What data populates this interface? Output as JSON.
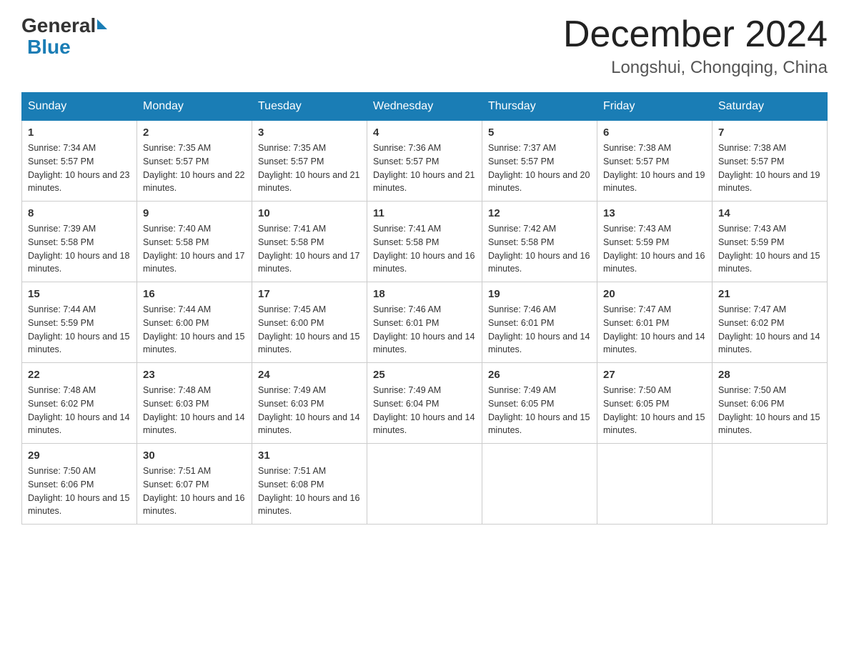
{
  "header": {
    "logo_general": "General",
    "logo_blue": "Blue",
    "month_title": "December 2024",
    "location": "Longshui, Chongqing, China"
  },
  "days_of_week": [
    "Sunday",
    "Monday",
    "Tuesday",
    "Wednesday",
    "Thursday",
    "Friday",
    "Saturday"
  ],
  "weeks": [
    [
      {
        "day": "1",
        "sunrise": "7:34 AM",
        "sunset": "5:57 PM",
        "daylight": "10 hours and 23 minutes."
      },
      {
        "day": "2",
        "sunrise": "7:35 AM",
        "sunset": "5:57 PM",
        "daylight": "10 hours and 22 minutes."
      },
      {
        "day": "3",
        "sunrise": "7:35 AM",
        "sunset": "5:57 PM",
        "daylight": "10 hours and 21 minutes."
      },
      {
        "day": "4",
        "sunrise": "7:36 AM",
        "sunset": "5:57 PM",
        "daylight": "10 hours and 21 minutes."
      },
      {
        "day": "5",
        "sunrise": "7:37 AM",
        "sunset": "5:57 PM",
        "daylight": "10 hours and 20 minutes."
      },
      {
        "day": "6",
        "sunrise": "7:38 AM",
        "sunset": "5:57 PM",
        "daylight": "10 hours and 19 minutes."
      },
      {
        "day": "7",
        "sunrise": "7:38 AM",
        "sunset": "5:57 PM",
        "daylight": "10 hours and 19 minutes."
      }
    ],
    [
      {
        "day": "8",
        "sunrise": "7:39 AM",
        "sunset": "5:58 PM",
        "daylight": "10 hours and 18 minutes."
      },
      {
        "day": "9",
        "sunrise": "7:40 AM",
        "sunset": "5:58 PM",
        "daylight": "10 hours and 17 minutes."
      },
      {
        "day": "10",
        "sunrise": "7:41 AM",
        "sunset": "5:58 PM",
        "daylight": "10 hours and 17 minutes."
      },
      {
        "day": "11",
        "sunrise": "7:41 AM",
        "sunset": "5:58 PM",
        "daylight": "10 hours and 16 minutes."
      },
      {
        "day": "12",
        "sunrise": "7:42 AM",
        "sunset": "5:58 PM",
        "daylight": "10 hours and 16 minutes."
      },
      {
        "day": "13",
        "sunrise": "7:43 AM",
        "sunset": "5:59 PM",
        "daylight": "10 hours and 16 minutes."
      },
      {
        "day": "14",
        "sunrise": "7:43 AM",
        "sunset": "5:59 PM",
        "daylight": "10 hours and 15 minutes."
      }
    ],
    [
      {
        "day": "15",
        "sunrise": "7:44 AM",
        "sunset": "5:59 PM",
        "daylight": "10 hours and 15 minutes."
      },
      {
        "day": "16",
        "sunrise": "7:44 AM",
        "sunset": "6:00 PM",
        "daylight": "10 hours and 15 minutes."
      },
      {
        "day": "17",
        "sunrise": "7:45 AM",
        "sunset": "6:00 PM",
        "daylight": "10 hours and 15 minutes."
      },
      {
        "day": "18",
        "sunrise": "7:46 AM",
        "sunset": "6:01 PM",
        "daylight": "10 hours and 14 minutes."
      },
      {
        "day": "19",
        "sunrise": "7:46 AM",
        "sunset": "6:01 PM",
        "daylight": "10 hours and 14 minutes."
      },
      {
        "day": "20",
        "sunrise": "7:47 AM",
        "sunset": "6:01 PM",
        "daylight": "10 hours and 14 minutes."
      },
      {
        "day": "21",
        "sunrise": "7:47 AM",
        "sunset": "6:02 PM",
        "daylight": "10 hours and 14 minutes."
      }
    ],
    [
      {
        "day": "22",
        "sunrise": "7:48 AM",
        "sunset": "6:02 PM",
        "daylight": "10 hours and 14 minutes."
      },
      {
        "day": "23",
        "sunrise": "7:48 AM",
        "sunset": "6:03 PM",
        "daylight": "10 hours and 14 minutes."
      },
      {
        "day": "24",
        "sunrise": "7:49 AM",
        "sunset": "6:03 PM",
        "daylight": "10 hours and 14 minutes."
      },
      {
        "day": "25",
        "sunrise": "7:49 AM",
        "sunset": "6:04 PM",
        "daylight": "10 hours and 14 minutes."
      },
      {
        "day": "26",
        "sunrise": "7:49 AM",
        "sunset": "6:05 PM",
        "daylight": "10 hours and 15 minutes."
      },
      {
        "day": "27",
        "sunrise": "7:50 AM",
        "sunset": "6:05 PM",
        "daylight": "10 hours and 15 minutes."
      },
      {
        "day": "28",
        "sunrise": "7:50 AM",
        "sunset": "6:06 PM",
        "daylight": "10 hours and 15 minutes."
      }
    ],
    [
      {
        "day": "29",
        "sunrise": "7:50 AM",
        "sunset": "6:06 PM",
        "daylight": "10 hours and 15 minutes."
      },
      {
        "day": "30",
        "sunrise": "7:51 AM",
        "sunset": "6:07 PM",
        "daylight": "10 hours and 16 minutes."
      },
      {
        "day": "31",
        "sunrise": "7:51 AM",
        "sunset": "6:08 PM",
        "daylight": "10 hours and 16 minutes."
      },
      null,
      null,
      null,
      null
    ]
  ]
}
